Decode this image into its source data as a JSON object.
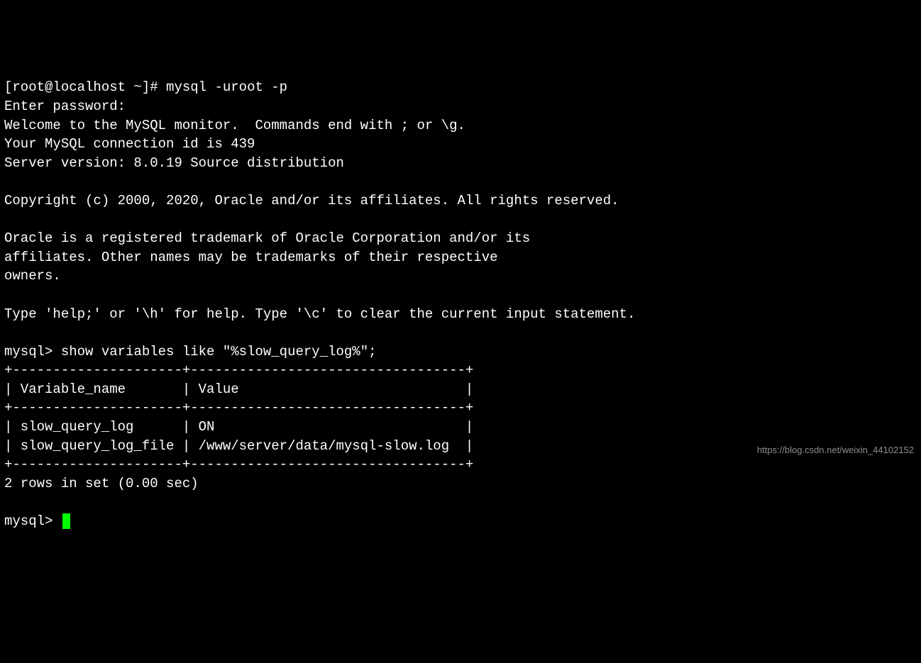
{
  "prompt_shell": "[root@localhost ~]# ",
  "cmd_mysql": "mysql -uroot -p",
  "line_enter_pw": "Enter password:",
  "line_welcome": "Welcome to the MySQL monitor.  Commands end with ; or \\g.",
  "line_conn_id": "Your MySQL connection id is 439",
  "line_server": "Server version: 8.0.19 Source distribution",
  "line_blank": "",
  "line_copyright": "Copyright (c) 2000, 2020, Oracle and/or its affiliates. All rights reserved.",
  "line_oracle1": "Oracle is a registered trademark of Oracle Corporation and/or its",
  "line_oracle2": "affiliates. Other names may be trademarks of their respective",
  "line_oracle3": "owners.",
  "line_help": "Type 'help;' or '\\h' for help. Type '\\c' to clear the current input statement.",
  "prompt_mysql": "mysql> ",
  "cmd_show": "show variables like \"%slow_query_log%\";",
  "tbl_border": "+---------------------+----------------------------------+",
  "tbl_header": "| Variable_name       | Value                            |",
  "tbl_row1": "| slow_query_log      | ON                               |",
  "tbl_row2": "| slow_query_log_file | /www/server/data/mysql-slow.log  |",
  "result_summary": "2 rows in set (0.00 sec)",
  "watermark": "https://blog.csdn.net/weixin_44102152",
  "table_data": {
    "columns": [
      "Variable_name",
      "Value"
    ],
    "rows": [
      [
        "slow_query_log",
        "ON"
      ],
      [
        "slow_query_log_file",
        "/www/server/data/mysql-slow.log"
      ]
    ]
  }
}
